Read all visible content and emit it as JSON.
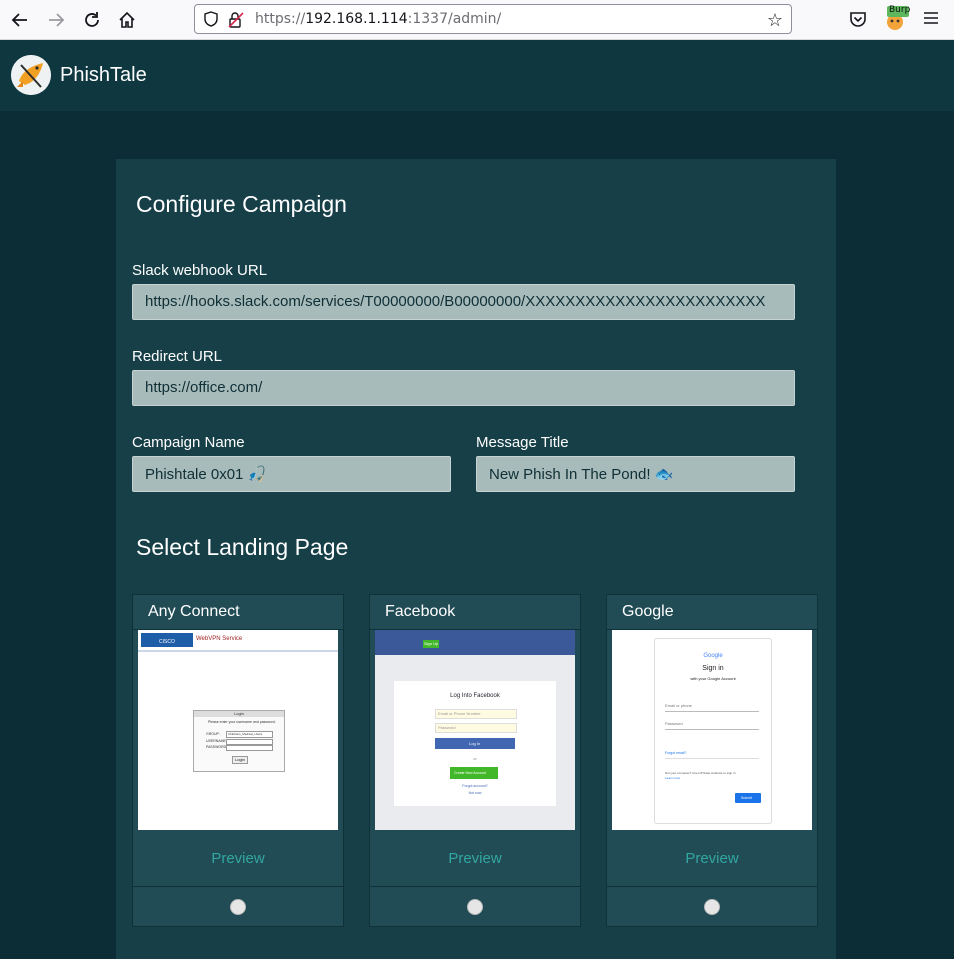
{
  "browser": {
    "url_scheme": "https://",
    "url_host": "192.168.1.114",
    "url_rest": ":1337/admin/",
    "back_icon": "arrow-left",
    "forward_icon": "arrow-right",
    "reload_icon": "reload",
    "home_icon": "home",
    "burp_badge": "Burp"
  },
  "app": {
    "brand": "PhishTale"
  },
  "configure": {
    "title": "Configure Campaign",
    "slack_label": "Slack webhook URL",
    "slack_value": "https://hooks.slack.com/services/T00000000/B00000000/XXXXXXXXXXXXXXXXXXXXXXXX",
    "redirect_label": "Redirect URL",
    "redirect_value": "https://office.com/",
    "campaign_label": "Campaign Name",
    "campaign_value": "Phishtale 0x01 🎣",
    "message_label": "Message Title",
    "message_value": "New Phish In The Pond! 🐟"
  },
  "landing": {
    "title": "Select Landing Page",
    "pages": [
      {
        "name": "Any Connect",
        "preview": "Preview",
        "thumb": {
          "brand": "CISCO",
          "service": "WebVPN Service",
          "login_header": "Login",
          "prompt": "Please enter your username and password.",
          "group_label": "GROUP:",
          "group_value": "Childrens_Medical_Users",
          "username_label": "USERNAME:",
          "password_label": "PASSWORD:",
          "button": "Login"
        }
      },
      {
        "name": "Facebook",
        "preview": "Preview",
        "thumb": {
          "signup": "Sign Up",
          "heading": "Log Into Facebook",
          "email_ph": "Email or Phone Number",
          "password_ph": "Password",
          "login": "Log In",
          "or": "or",
          "create": "Create New Account",
          "forgot": "Forgot account?",
          "notnow": "Not now"
        }
      },
      {
        "name": "Google",
        "preview": "Preview",
        "thumb": {
          "logo": "Google",
          "heading": "Sign in",
          "sub": "with your Google Account",
          "email_ph": "Email or phone",
          "password_ph": "Password",
          "forgot": "Forgot email?",
          "note": "Not your computer? Use InPrivate windows to sign in.",
          "learn": "Learn more",
          "submit": "Submit"
        }
      }
    ]
  }
}
